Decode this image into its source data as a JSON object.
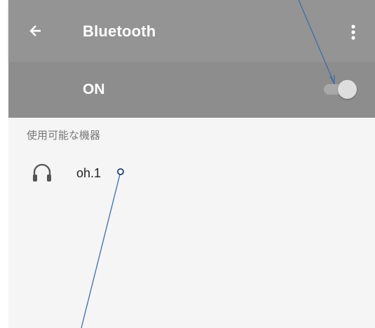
{
  "app_bar": {
    "back_icon": "arrow-back-icon",
    "title": "Bluetooth",
    "more_icon": "more-vert-icon"
  },
  "toggle_bar": {
    "label": "ON",
    "switch_state": "on"
  },
  "available_devices": {
    "header": "使用可能な機器",
    "items": [
      {
        "name": "oh.1",
        "icon": "headphones-icon"
      }
    ]
  },
  "colors": {
    "app_bar_bg": "#949494",
    "toggle_bar_bg": "#8d8d8d",
    "content_bg": "#f5f5f5",
    "annotation_line": "#3e6ea8"
  }
}
